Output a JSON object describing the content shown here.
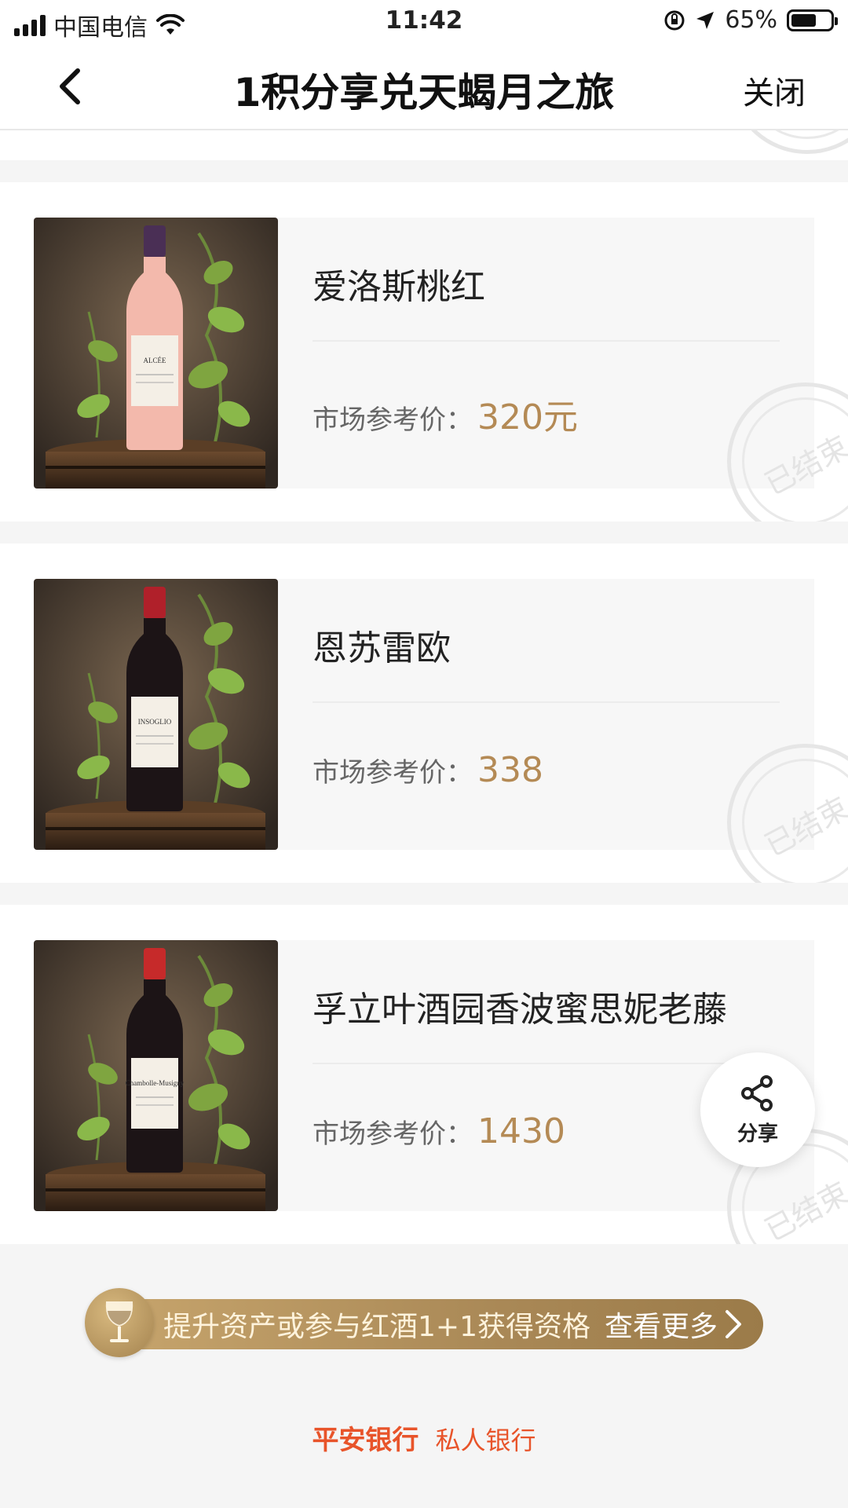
{
  "status_bar": {
    "carrier": "中国电信",
    "time": "11:42",
    "battery": "65%",
    "battery_level": 0.65
  },
  "nav": {
    "title": "1积分享兑天蝎月之旅",
    "close_label": "关闭",
    "back_icon": "chevron-left-icon"
  },
  "products": [
    {
      "name": "爱洛斯桃红",
      "price_label": "市场参考价：",
      "price": "320元",
      "bottle_color": "#f3b9ac",
      "capsule_color": "#4a2f55",
      "bottle_label": "ALCÉE",
      "stamp": "已结束"
    },
    {
      "name": "恩苏雷欧",
      "price_label": "市场参考价：",
      "price": "338",
      "bottle_color": "#1c1416",
      "capsule_color": "#b0202a",
      "bottle_label": "INSOGLIO",
      "stamp": "已结束"
    },
    {
      "name": "孚立叶酒园香波蜜思妮老藤",
      "price_label": "市场参考价：",
      "price": "1430",
      "bottle_color": "#1c1416",
      "capsule_color": "#c62a2a",
      "bottle_label": "Chambolle-Musigny",
      "stamp": "已结束"
    }
  ],
  "share": {
    "label": "分享",
    "icon": "share-icon"
  },
  "banner": {
    "text": "提升资产或参与红酒1+1获得资格",
    "link": "查看更多",
    "icon": "wine-glass-icon"
  },
  "footer": {
    "brand": "平安银行",
    "sub": "私人银行"
  },
  "colors": {
    "accent_gold": "#b48a55",
    "brand_orange": "#e8542a"
  }
}
